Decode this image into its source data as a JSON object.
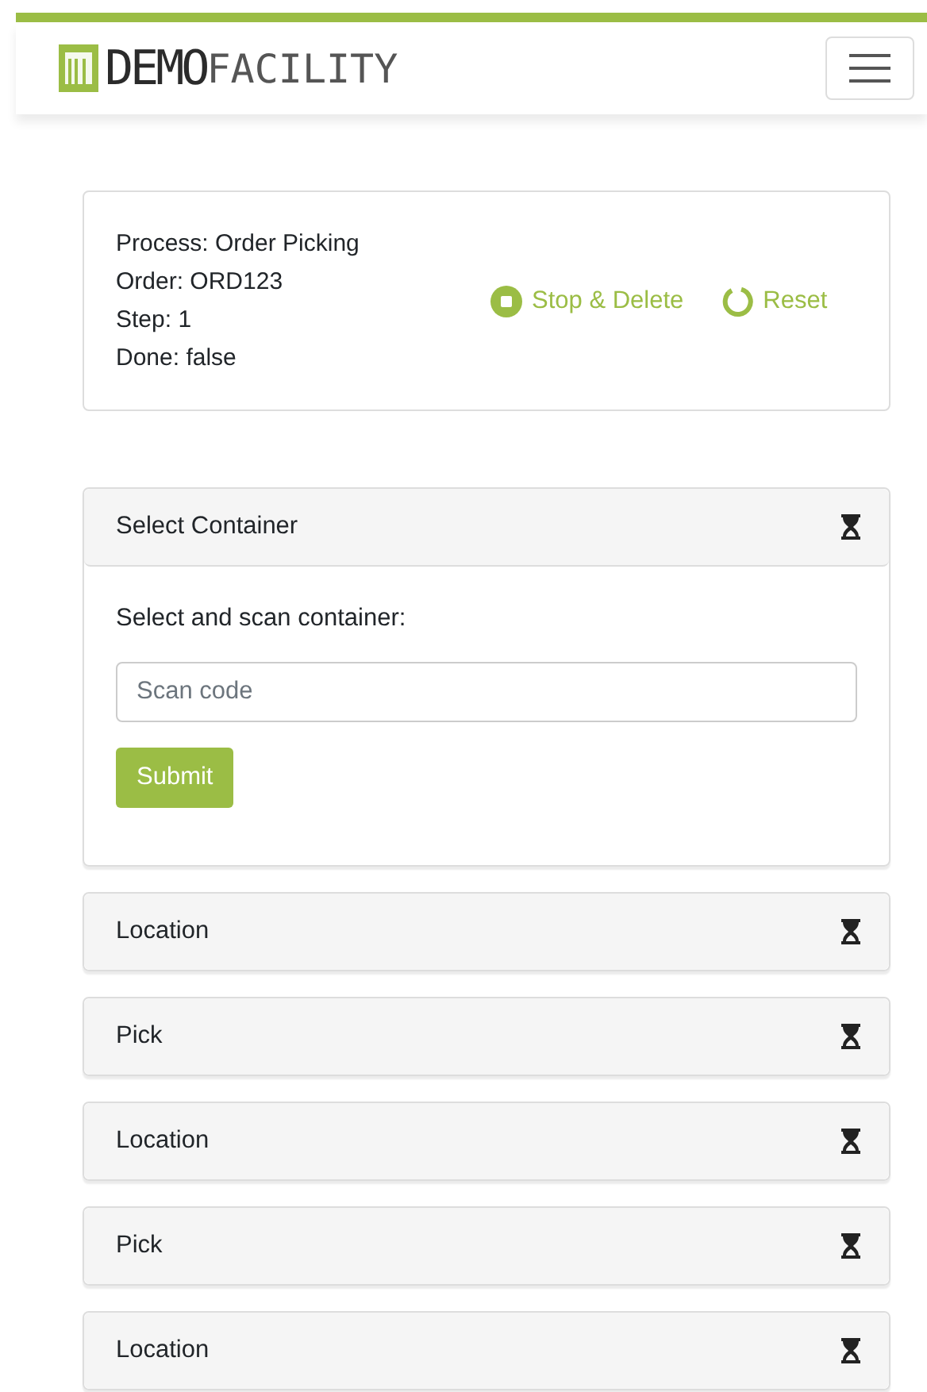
{
  "header": {
    "logo_primary": "DEMO",
    "logo_secondary": "FACILITY"
  },
  "process": {
    "lines": [
      "Process: Order Picking",
      "Order: ORD123",
      "Step: 1",
      "Done: false"
    ],
    "actions": [
      {
        "kind": "stop",
        "label": "Stop & Delete"
      },
      {
        "kind": "reset",
        "label": "Reset"
      }
    ]
  },
  "steps": [
    {
      "title": "Select Container",
      "expanded": true,
      "prompt": "Select and scan container:",
      "placeholder": "Scan code",
      "button": "Submit"
    },
    {
      "title": "Location",
      "expanded": false
    },
    {
      "title": "Pick",
      "expanded": false
    },
    {
      "title": "Location",
      "expanded": false
    },
    {
      "title": "Pick",
      "expanded": false
    },
    {
      "title": "Location",
      "expanded": false
    }
  ]
}
